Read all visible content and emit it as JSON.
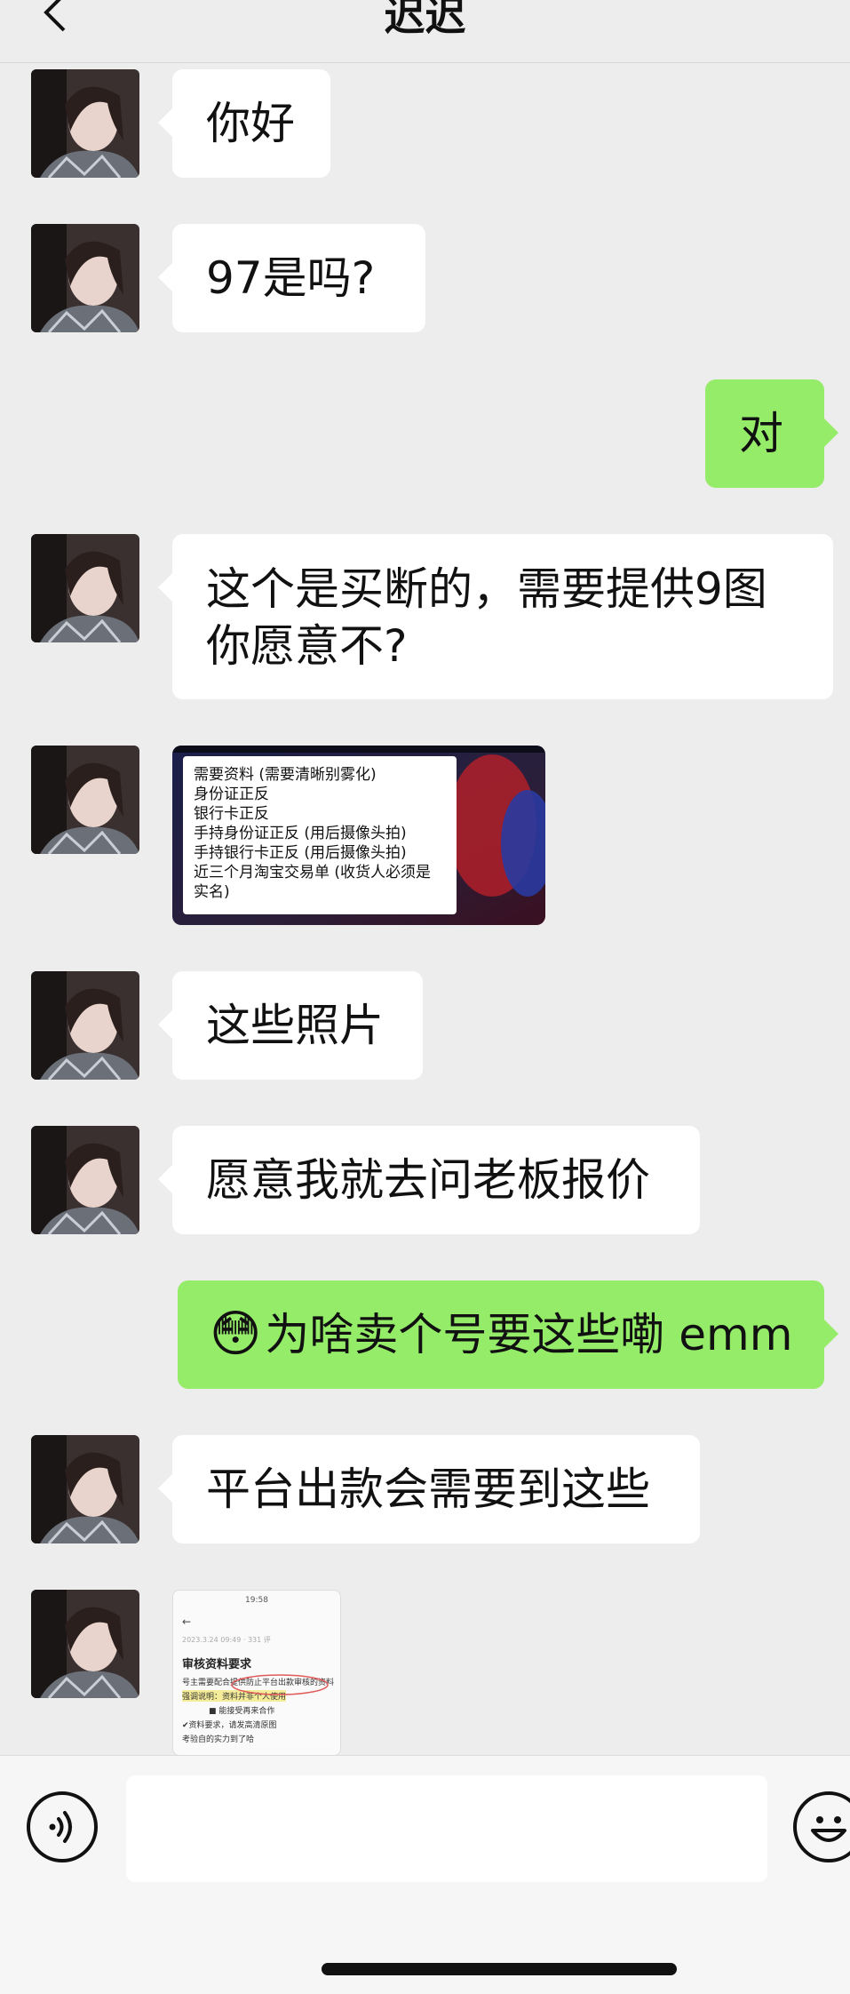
{
  "header": {
    "title": "迟迟",
    "back_icon": "chevron-left-icon"
  },
  "contact": {
    "avatar": "avatar-portrait"
  },
  "messages": [
    {
      "side": "in",
      "type": "text",
      "text": "你好"
    },
    {
      "side": "in",
      "type": "text",
      "text": "97是吗?"
    },
    {
      "side": "out",
      "type": "text",
      "text": "对"
    },
    {
      "side": "in",
      "type": "text",
      "lines": [
        "这个是买断的，需要提供9图",
        "你愿意不?"
      ]
    },
    {
      "side": "in",
      "type": "image",
      "lines": [
        "需要资料 (需要清晰别雾化)",
        "身份证正反",
        "银行卡正反",
        "手持身份证正反 (用后摄像头拍)",
        "手持银行卡正反 (用后摄像头拍)",
        "近三个月淘宝交易单 (收货人必须是实名)"
      ]
    },
    {
      "side": "in",
      "type": "text",
      "text": "这些照片"
    },
    {
      "side": "in",
      "type": "text",
      "text": "愿意我就去问老板报价"
    },
    {
      "side": "out",
      "type": "text",
      "emoji": "😳",
      "text": "为啥卖个号要这些嘞 emm"
    },
    {
      "side": "in",
      "type": "text",
      "text": "平台出款会需要到这些"
    },
    {
      "side": "in",
      "type": "screenshot",
      "status_time": "19:58",
      "date": "2023.3.24 09:49 · 331 评",
      "heading": "审核资料要求",
      "lines": [
        "号主需要配合提供防止平台出款审核的资料",
        "强调说明：资料并非个人使用",
        "■ 能接受再来合作",
        "✔资料要求，请发高清原图",
        "考验自的实力到了哈"
      ]
    }
  ],
  "composer": {
    "voice_icon": "voice-icon",
    "input_value": "",
    "emoji_icon": "emoji-icon"
  },
  "colors": {
    "background": "#ededed",
    "incoming_bubble": "#ffffff",
    "outgoing_bubble": "#95ec69"
  }
}
